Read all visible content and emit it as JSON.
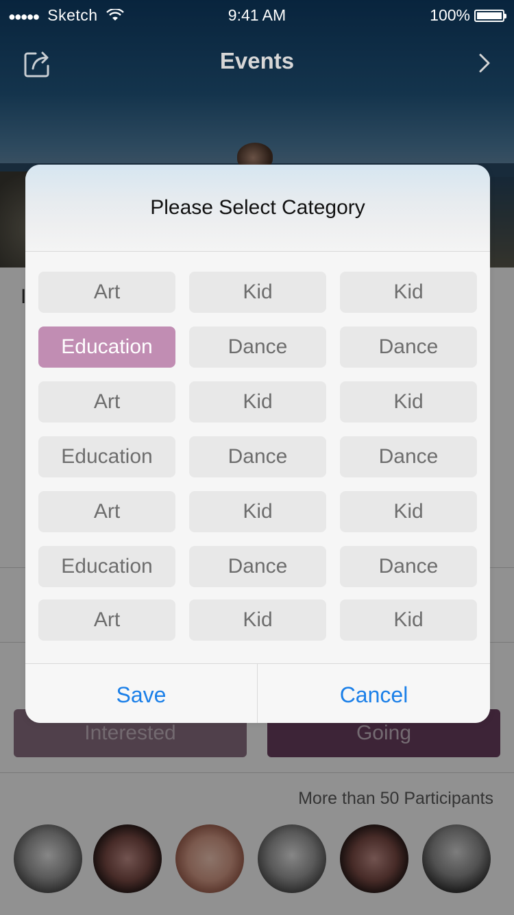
{
  "status_bar": {
    "carrier": "Sketch",
    "time": "9:41 AM",
    "battery": "100%"
  },
  "nav": {
    "title": "Events",
    "share_icon": "share-icon",
    "next_icon": "chevron-right-icon"
  },
  "actions": {
    "interested": "Interested",
    "going": "Going"
  },
  "participants_text": "More than 50 Participants",
  "modal": {
    "title": "Please Select Category",
    "selected": "Education",
    "rows": [
      [
        "Art",
        "Kid",
        "Kid"
      ],
      [
        "Education",
        "Dance",
        "Dance"
      ],
      [
        "Art",
        "Kid",
        "Kid"
      ],
      [
        "Education",
        "Dance",
        "Dance"
      ],
      [
        "Art",
        "Kid",
        "Kid"
      ],
      [
        "Education",
        "Dance",
        "Dance"
      ],
      [
        "Art",
        "Kid",
        "Kid"
      ]
    ],
    "save_label": "Save",
    "cancel_label": "Cancel"
  },
  "colors": {
    "accent_selected": "#c18db3",
    "link_blue": "#1a7fe8",
    "chip_bg": "#e8e8e8"
  }
}
